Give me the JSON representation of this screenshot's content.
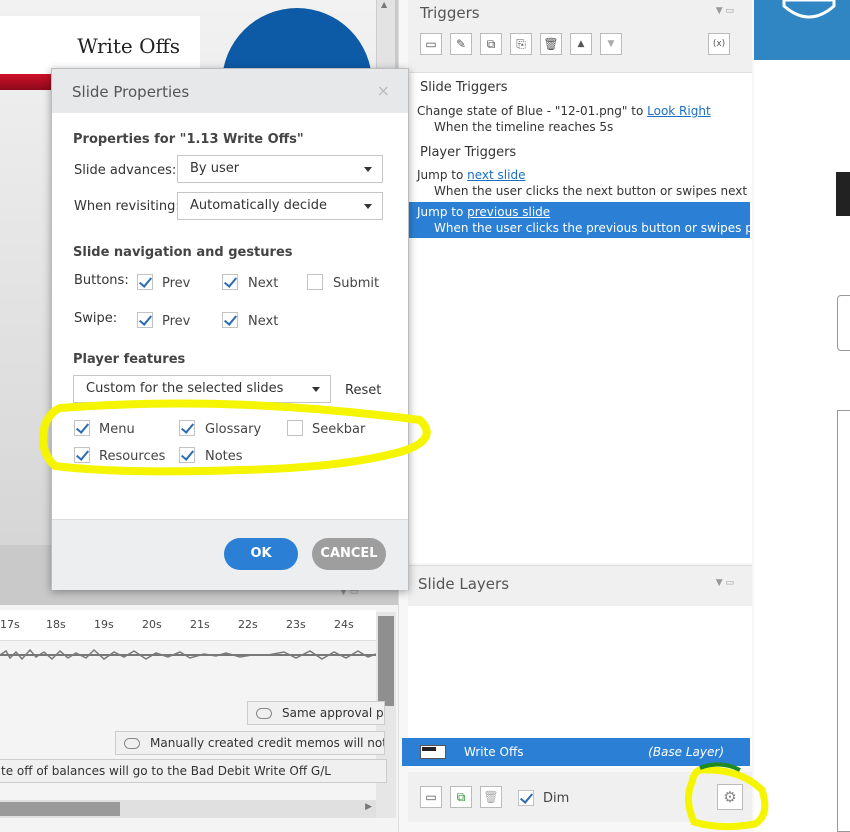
{
  "slide": {
    "title": "Write Offs"
  },
  "timeline": {
    "ticks": [
      "17s",
      "18s",
      "19s",
      "20s",
      "21s",
      "22s",
      "23s",
      "24s"
    ],
    "cues": [
      "Same approval pro",
      "Manually created credit memos will not",
      "te off of balances will go to the Bad Debit Write Off G/L"
    ]
  },
  "triggers_panel": {
    "title": "Triggers",
    "slide_triggers_heading": "Slide Triggers",
    "t1_action": "Change state of Blue - \"12-01.png\" to",
    "t1_link": "Look Right",
    "t1_when": "When the timeline reaches 5s",
    "player_triggers_heading": "Player Triggers",
    "t2_action": "Jump to",
    "t2_link": "next slide",
    "t2_when": "When the user clicks the next button or swipes next",
    "t3_action": "Jump to",
    "t3_link": "previous slide",
    "t3_when": "When the user clicks the previous button or swipes prev..."
  },
  "layers_panel": {
    "title": "Slide Layers",
    "layer_name": "Write Offs",
    "layer_tag": "(Base Layer)",
    "dim_label": "Dim",
    "dim_checked": true
  },
  "dialog": {
    "title": "Slide Properties",
    "close": "×",
    "properties_for": "Properties for \"1.13 Write Offs\"",
    "slide_advances_label": "Slide advances:",
    "slide_advances_value": "By user",
    "revisiting_label": "When revisiting:",
    "revisiting_value": "Automatically decide",
    "nav_heading": "Slide navigation and gestures",
    "buttons_label": "Buttons:",
    "swipe_label": "Swipe:",
    "prev": "Prev",
    "next": "Next",
    "submit": "Submit",
    "player_features_heading": "Player features",
    "player_features_value": "Custom for the selected slides",
    "reset": "Reset",
    "menu": "Menu",
    "glossary": "Glossary",
    "seekbar": "Seekbar",
    "resources": "Resources",
    "notes": "Notes",
    "ok": "OK",
    "cancel": "CANCEL"
  },
  "colors": {
    "accent": "#2b80d6",
    "ok_button": "#2b80d6",
    "cancel_button": "#9e9e9e",
    "highlight": "#ffff00"
  }
}
